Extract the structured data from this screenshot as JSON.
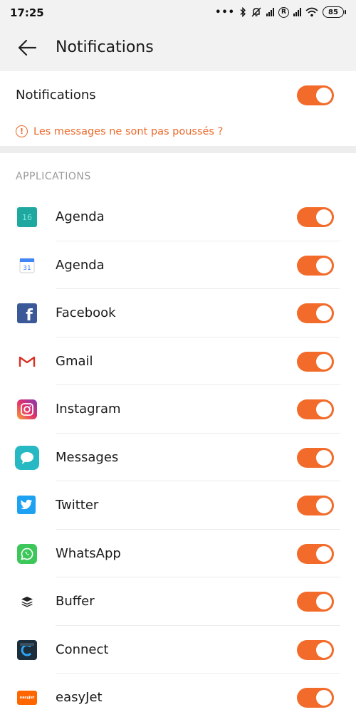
{
  "status_bar": {
    "time": "17:25",
    "dots": "•••",
    "battery": "85",
    "roaming_badge": "R"
  },
  "header": {
    "title": "Notifications",
    "back_icon": "arrow-left-icon"
  },
  "master": {
    "label": "Notifications",
    "enabled": true,
    "warning_text": "Les messages ne sont pas poussés ?",
    "warning_icon": "!"
  },
  "section": {
    "title": "APPLICATIONS"
  },
  "apps": [
    {
      "name": "Agenda",
      "icon": "agenda-teal-icon",
      "icon_text": "16",
      "enabled": true
    },
    {
      "name": "Agenda",
      "icon": "google-calendar-icon",
      "icon_text": "31",
      "enabled": true
    },
    {
      "name": "Facebook",
      "icon": "facebook-icon",
      "icon_text": "f",
      "enabled": true
    },
    {
      "name": "Gmail",
      "icon": "gmail-icon",
      "icon_text": "M",
      "enabled": true
    },
    {
      "name": "Instagram",
      "icon": "instagram-icon",
      "icon_text": "",
      "enabled": true
    },
    {
      "name": "Messages",
      "icon": "messages-icon",
      "icon_text": "",
      "enabled": true
    },
    {
      "name": "Twitter",
      "icon": "twitter-icon",
      "icon_text": "",
      "enabled": true
    },
    {
      "name": "WhatsApp",
      "icon": "whatsapp-icon",
      "icon_text": "",
      "enabled": true
    },
    {
      "name": "Buffer",
      "icon": "buffer-icon",
      "icon_text": "",
      "enabled": true
    },
    {
      "name": "Connect",
      "icon": "connect-icon",
      "icon_text": "",
      "enabled": true
    },
    {
      "name": "easyJet",
      "icon": "easyjet-icon",
      "icon_text": "easyJet",
      "enabled": true
    }
  ],
  "colors": {
    "accent": "#f26b2a",
    "warning": "#ec6a2a",
    "background_header": "#f2f2f2"
  }
}
